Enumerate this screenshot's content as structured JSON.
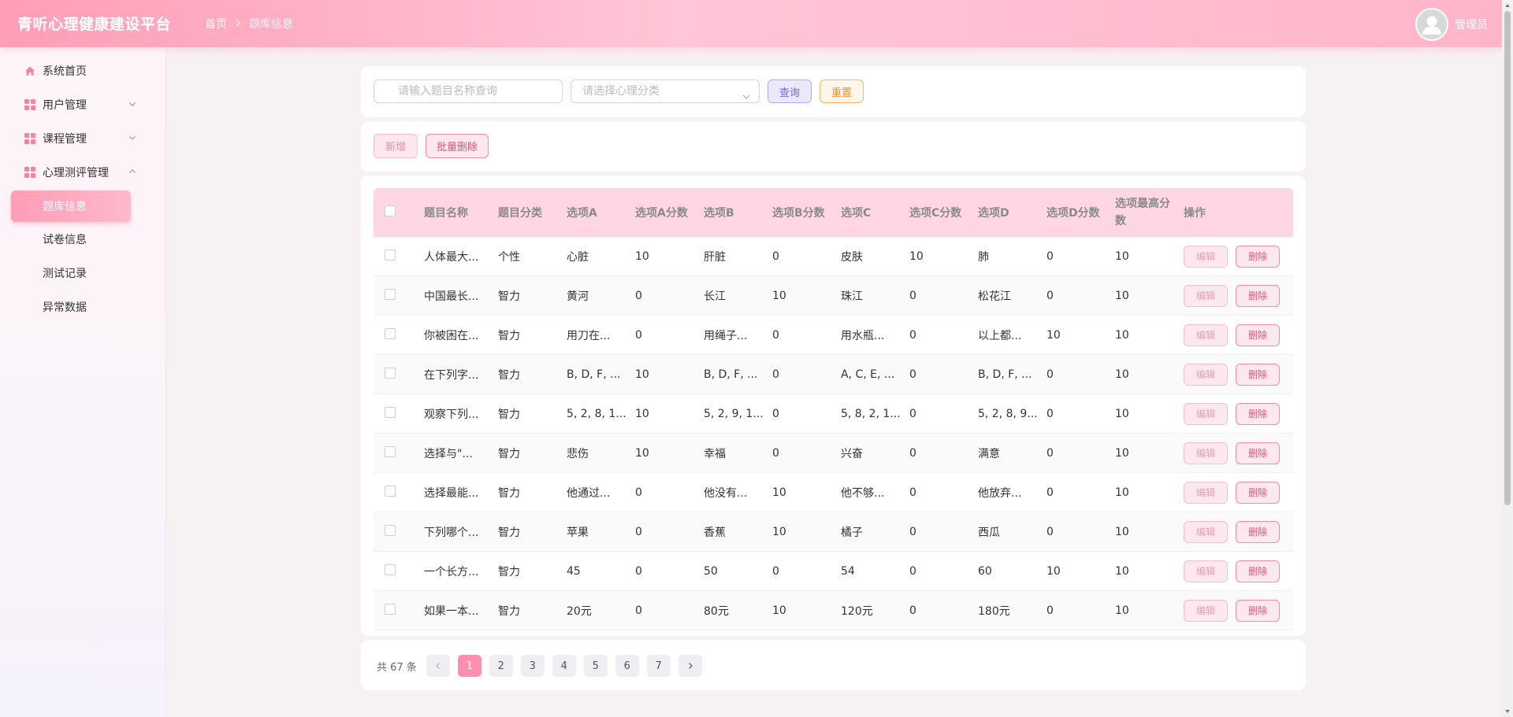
{
  "header": {
    "app_title": "青听心理健康建设平台",
    "breadcrumb": [
      "首页",
      "题库信息"
    ],
    "user_name": "管理员"
  },
  "sidebar": {
    "items": [
      {
        "label": "系统首页",
        "icon": "home-icon"
      },
      {
        "label": "用户管理",
        "icon": "grid-icon",
        "expanded": false
      },
      {
        "label": "课程管理",
        "icon": "grid-icon",
        "expanded": false
      },
      {
        "label": "心理测评管理",
        "icon": "grid-icon",
        "expanded": true
      }
    ],
    "sub_items": [
      {
        "label": "题库信息",
        "active": true
      },
      {
        "label": "试卷信息",
        "active": false
      },
      {
        "label": "测试记录",
        "active": false
      },
      {
        "label": "异常数据",
        "active": false
      }
    ]
  },
  "search": {
    "name_placeholder": "请输入题目名称查询",
    "category_placeholder": "请选择心理分类",
    "query_label": "查询",
    "reset_label": "重置"
  },
  "actions": {
    "add_label": "新增",
    "batch_delete_label": "批量删除"
  },
  "table": {
    "headers": [
      "题目名称",
      "题目分类",
      "选项A",
      "选项A分数",
      "选项B",
      "选项B分数",
      "选项C",
      "选项C分数",
      "选项D",
      "选项D分数",
      "选项最高分数",
      "操作"
    ],
    "edit_label": "编辑",
    "delete_label": "删除",
    "rows": [
      {
        "name": "人体最大...",
        "category": "个性",
        "a": "心脏",
        "a_score": "10",
        "b": "肝脏",
        "b_score": "0",
        "c": "皮肤",
        "c_score": "10",
        "d": "肺",
        "d_score": "0",
        "max": "10"
      },
      {
        "name": "中国最长...",
        "category": "智力",
        "a": "黄河",
        "a_score": "0",
        "b": "长江",
        "b_score": "10",
        "c": "珠江",
        "c_score": "0",
        "d": "松花江",
        "d_score": "0",
        "max": "10"
      },
      {
        "name": "你被困在...",
        "category": "智力",
        "a": "用刀在...",
        "a_score": "0",
        "b": "用绳子...",
        "b_score": "0",
        "c": "用水瓶...",
        "c_score": "0",
        "d": "以上都...",
        "d_score": "10",
        "max": "10"
      },
      {
        "name": "在下列字...",
        "category": "智力",
        "a": "B, D, F, ...",
        "a_score": "10",
        "b": "B, D, F, ...",
        "b_score": "0",
        "c": "A, C, E, ...",
        "c_score": "0",
        "d": "B, D, F, ...",
        "d_score": "0",
        "max": "10"
      },
      {
        "name": "观察下列...",
        "category": "智力",
        "a": "5, 2, 8, 1...",
        "a_score": "10",
        "b": "5, 2, 9, 1...",
        "b_score": "0",
        "c": "5, 8, 2, 1...",
        "c_score": "0",
        "d": "5, 2, 8, 9...",
        "d_score": "0",
        "max": "10"
      },
      {
        "name": "选择与\"...",
        "category": "智力",
        "a": "悲伤",
        "a_score": "10",
        "b": "幸福",
        "b_score": "0",
        "c": "兴奋",
        "c_score": "0",
        "d": "满意",
        "d_score": "0",
        "max": "10"
      },
      {
        "name": "选择最能...",
        "category": "智力",
        "a": "他通过...",
        "a_score": "0",
        "b": "他没有...",
        "b_score": "10",
        "c": "他不够...",
        "c_score": "0",
        "d": "他放弃...",
        "d_score": "0",
        "max": "10"
      },
      {
        "name": "下列哪个...",
        "category": "智力",
        "a": "苹果",
        "a_score": "0",
        "b": "香蕉",
        "b_score": "10",
        "c": "橘子",
        "c_score": "0",
        "d": "西瓜",
        "d_score": "0",
        "max": "10"
      },
      {
        "name": "一个长方...",
        "category": "智力",
        "a": "45",
        "a_score": "0",
        "b": "50",
        "b_score": "0",
        "c": "54",
        "c_score": "0",
        "d": "60",
        "d_score": "10",
        "max": "10"
      },
      {
        "name": "如果一本...",
        "category": "智力",
        "a": "20元",
        "a_score": "0",
        "b": "80元",
        "b_score": "10",
        "c": "120元",
        "c_score": "0",
        "d": "180元",
        "d_score": "0",
        "max": "10"
      }
    ]
  },
  "pagination": {
    "total_label": "共 67 条",
    "pages": [
      "1",
      "2",
      "3",
      "4",
      "5",
      "6",
      "7"
    ],
    "current": "1"
  },
  "colors": {
    "accent": "#ff8fae",
    "header_start": "#ff9eb6",
    "header_end": "#ffb5c9"
  }
}
